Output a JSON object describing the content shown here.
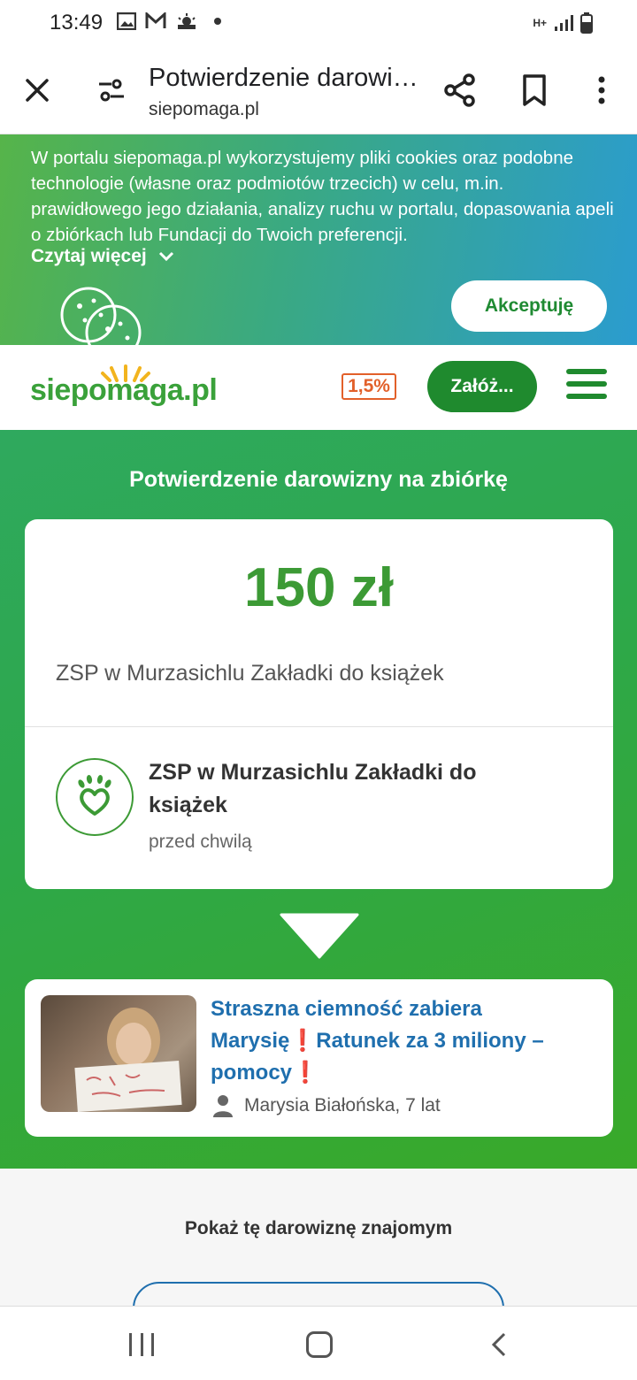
{
  "status_bar": {
    "time": "13:49",
    "network": "H+"
  },
  "browser": {
    "title": "Potwierdzenie darowizny na zbiórkę",
    "url": "siepomaga.pl",
    "icons": [
      "close-icon",
      "tune-icon",
      "share-icon",
      "bookmark-icon",
      "more-vert-icon"
    ]
  },
  "cookie_banner": {
    "text": "W portalu siepomaga.pl wykorzystujemy pliki cookies oraz podobne technologie (własne oraz podmiotów trzecich) w celu, m.in. prawidłowego jego działania, analizy ruchu w portalu, dopasowania apeli o zbiórkach lub Fundacji do Twoich preferencji.",
    "read_more": "Czytaj więcej",
    "accept_label": "Akceptuję"
  },
  "header": {
    "logo_text": "siepomaga.pl",
    "percent_badge": "1,5%",
    "found_button": "Załóż...",
    "colors": {
      "brand_green": "#1f8a2e",
      "badge_orange": "#e2602a"
    }
  },
  "main": {
    "section_title": "Potwierdzenie darowizny na zbiórkę",
    "donation": {
      "amount": "150 zł",
      "campaign": "ZSP w Murzasichlu Zakładki do książek",
      "org_name": "ZSP w Murzasichlu Zakładki do książek",
      "time": "przed chwilą"
    },
    "promo": {
      "title_part1": "Straszna ciemność zabiera Marysię",
      "title_part2": "Ratunek za 3 miliony – pomocy",
      "author": "Marysia Białońska, 7 lat"
    }
  },
  "share": {
    "title": "Pokaż tę darowiznę znajomym"
  }
}
